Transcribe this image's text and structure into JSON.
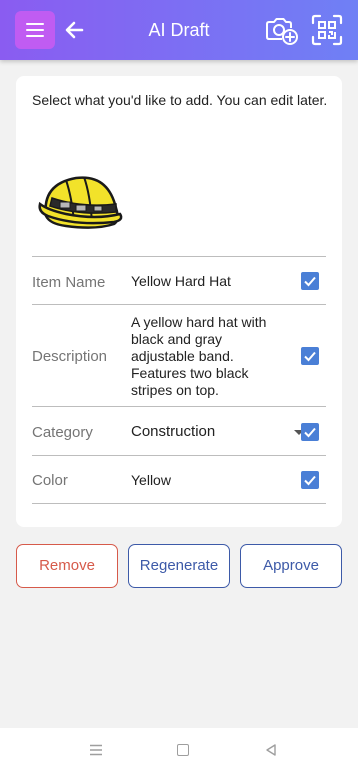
{
  "header": {
    "title": "AI Draft",
    "accent_color": "#8a5cf1",
    "menu_button_color": "#c05cf2",
    "icons": [
      "menu-icon",
      "back-arrow-icon",
      "camera-add-icon",
      "qr-scan-icon"
    ]
  },
  "card": {
    "intro": "Select what you'd like to add. You can edit later.",
    "image_icon": "yellow-hard-hat",
    "fields": [
      {
        "label": "Item Name",
        "value": "Yellow Hard Hat",
        "checked": true
      },
      {
        "label": "Description",
        "value": "A yellow hard hat with black and gray adjustable band. Features two black stripes on top.",
        "checked": true
      },
      {
        "label": "Category",
        "value": "Construction",
        "checked": true
      },
      {
        "label": "Color",
        "value": "Yellow",
        "checked": true
      }
    ],
    "checkbox_color": "#4a7fd6"
  },
  "actions": {
    "remove": "Remove",
    "regenerate": "Regenerate",
    "approve": "Approve",
    "remove_color": "#d65a4a",
    "primary_color": "#3d5aa8"
  },
  "system_nav": {
    "icons": [
      "home-lines-icon",
      "recent-apps-icon",
      "back-triangle-icon"
    ]
  }
}
